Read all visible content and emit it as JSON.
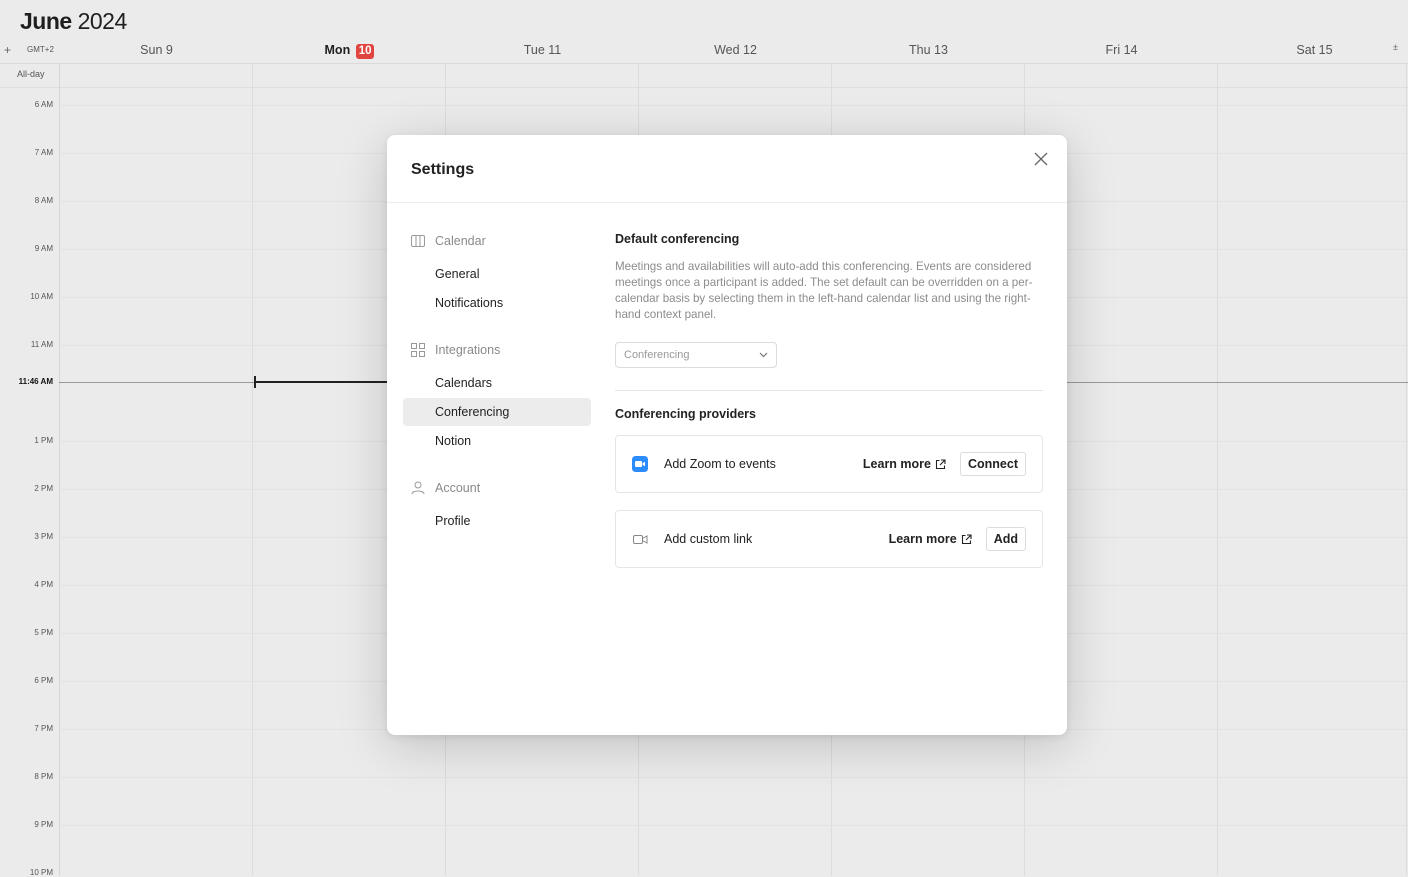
{
  "calendar": {
    "month": "June",
    "year": "2024",
    "add_label": "+",
    "timezone": "GMT+2",
    "collapse_label": "±",
    "all_day_label": "All-day",
    "days": [
      {
        "label": "Sun 9",
        "today": false
      },
      {
        "label": "Mon",
        "badge": "10",
        "today": true
      },
      {
        "label": "Tue 11",
        "today": false
      },
      {
        "label": "Wed 12",
        "today": false
      },
      {
        "label": "Thu 13",
        "today": false
      },
      {
        "label": "Fri 14",
        "today": false
      },
      {
        "label": "Sat 15",
        "today": false
      }
    ],
    "hours": [
      "6 AM",
      "7 AM",
      "8 AM",
      "9 AM",
      "10 AM",
      "11 AM",
      "1 PM",
      "2 PM",
      "3 PM",
      "4 PM",
      "5 PM",
      "6 PM",
      "7 PM",
      "8 PM",
      "9 PM",
      "10 PM"
    ],
    "current_time": "11:46 AM",
    "today_color": "#e0463f"
  },
  "settings": {
    "title": "Settings",
    "close_icon": "close-icon",
    "nav": {
      "calendar_group": "Calendar",
      "general": "General",
      "notifications": "Notifications",
      "integrations_group": "Integrations",
      "calendars": "Calendars",
      "conferencing": "Conferencing",
      "notion": "Notion",
      "account_group": "Account",
      "profile": "Profile"
    },
    "active_item": "Conferencing",
    "default_conferencing": {
      "title": "Default conferencing",
      "description": "Meetings and availabilities will auto-add this conferencing. Events are considered meetings once a participant is added. The set default can be overridden on a per-calendar basis by selecting them in the left-hand calendar list and using the right-hand context panel.",
      "select_value": "Conferencing"
    },
    "providers": {
      "title": "Conferencing providers",
      "zoom": {
        "name": "Add Zoom to events",
        "learn_more": "Learn more",
        "button": "Connect",
        "icon": "zoom-icon",
        "color": "#2d8cff"
      },
      "custom": {
        "name": "Add custom link",
        "learn_more": "Learn more",
        "button": "Add",
        "icon": "video-camera-icon"
      }
    }
  }
}
